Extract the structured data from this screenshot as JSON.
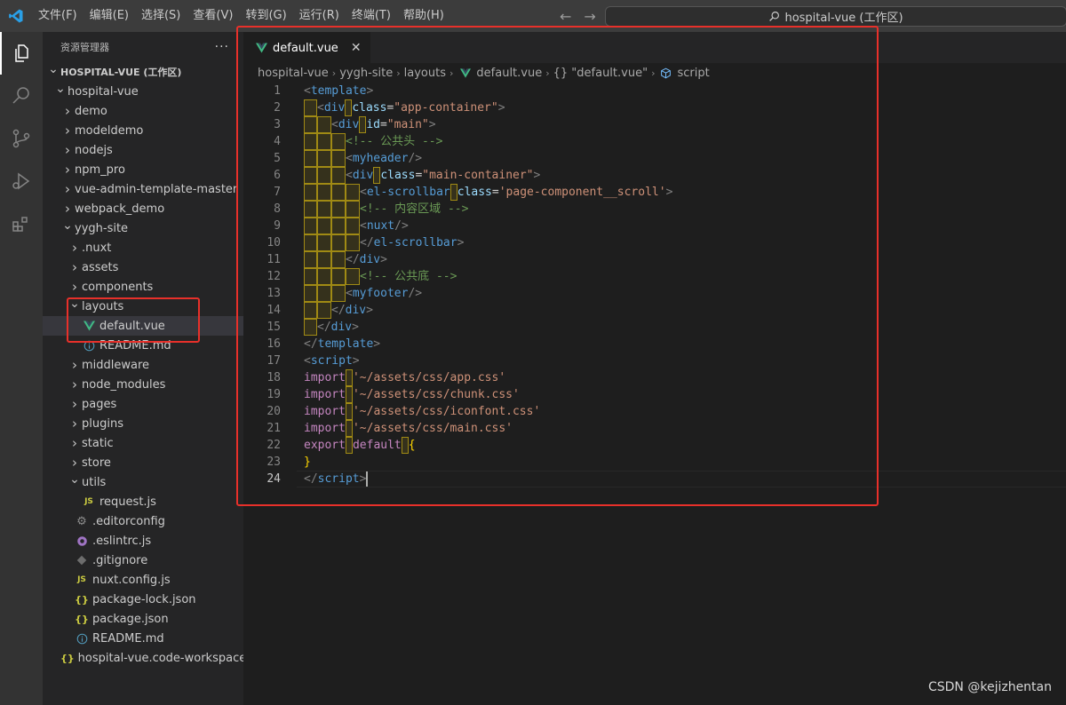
{
  "titlebar": {
    "menus": [
      "文件(F)",
      "编辑(E)",
      "选择(S)",
      "查看(V)",
      "转到(G)",
      "运行(R)",
      "终端(T)",
      "帮助(H)"
    ],
    "search_text": "hospital-vue (工作区)",
    "search_icon": "search-icon"
  },
  "activitybar": {
    "icons": [
      "explorer-icon",
      "search-icon",
      "source-control-icon",
      "run-debug-icon",
      "extensions-icon"
    ]
  },
  "sidebar": {
    "header": "资源管理器",
    "more": "···",
    "items": [
      {
        "label": "HOSPITAL-VUE (工作区)",
        "depth": 0,
        "kind": "workspace",
        "chev": "v"
      },
      {
        "label": "hospital-vue",
        "depth": 1,
        "kind": "folder",
        "chev": "v"
      },
      {
        "label": "demo",
        "depth": 2,
        "kind": "folder",
        "chev": ">"
      },
      {
        "label": "modeldemo",
        "depth": 2,
        "kind": "folder",
        "chev": ">"
      },
      {
        "label": "nodejs",
        "depth": 2,
        "kind": "folder",
        "chev": ">"
      },
      {
        "label": "npm_pro",
        "depth": 2,
        "kind": "folder",
        "chev": ">"
      },
      {
        "label": "vue-admin-template-master",
        "depth": 2,
        "kind": "folder",
        "chev": ">"
      },
      {
        "label": "webpack_demo",
        "depth": 2,
        "kind": "folder",
        "chev": ">"
      },
      {
        "label": "yygh-site",
        "depth": 2,
        "kind": "folder",
        "chev": "v"
      },
      {
        "label": ".nuxt",
        "depth": 3,
        "kind": "folder",
        "chev": ">"
      },
      {
        "label": "assets",
        "depth": 3,
        "kind": "folder",
        "chev": ">"
      },
      {
        "label": "components",
        "depth": 3,
        "kind": "folder",
        "chev": ">"
      },
      {
        "label": "layouts",
        "depth": 3,
        "kind": "folder",
        "chev": "v"
      },
      {
        "label": "default.vue",
        "depth": 4,
        "kind": "vue",
        "selected": true
      },
      {
        "label": "README.md",
        "depth": 4,
        "kind": "info"
      },
      {
        "label": "middleware",
        "depth": 3,
        "kind": "folder",
        "chev": ">"
      },
      {
        "label": "node_modules",
        "depth": 3,
        "kind": "folder",
        "chev": ">"
      },
      {
        "label": "pages",
        "depth": 3,
        "kind": "folder",
        "chev": ">"
      },
      {
        "label": "plugins",
        "depth": 3,
        "kind": "folder",
        "chev": ">"
      },
      {
        "label": "static",
        "depth": 3,
        "kind": "folder",
        "chev": ">"
      },
      {
        "label": "store",
        "depth": 3,
        "kind": "folder",
        "chev": ">"
      },
      {
        "label": "utils",
        "depth": 3,
        "kind": "folder",
        "chev": "v"
      },
      {
        "label": "request.js",
        "depth": 4,
        "kind": "js"
      },
      {
        "label": ".editorconfig",
        "depth": 3,
        "kind": "gear"
      },
      {
        "label": ".eslintrc.js",
        "depth": 3,
        "kind": "eslint"
      },
      {
        "label": ".gitignore",
        "depth": 3,
        "kind": "git"
      },
      {
        "label": "nuxt.config.js",
        "depth": 3,
        "kind": "js"
      },
      {
        "label": "package-lock.json",
        "depth": 3,
        "kind": "json"
      },
      {
        "label": "package.json",
        "depth": 3,
        "kind": "json"
      },
      {
        "label": "README.md",
        "depth": 3,
        "kind": "info"
      },
      {
        "label": "hospital-vue.code-workspace",
        "depth": 2,
        "kind": "json"
      }
    ]
  },
  "editor": {
    "tab": {
      "label": "default.vue",
      "close": "✕"
    },
    "breadcrumb": [
      "hospital-vue",
      "yygh-site",
      "layouts",
      "default.vue",
      "{} \"default.vue\"",
      "script"
    ],
    "current_line": 24,
    "lines": [
      [
        0,
        [
          [
            "t-punc",
            "<"
          ],
          [
            "t-tag",
            "template"
          ],
          [
            "t-punc",
            ">"
          ]
        ]
      ],
      [
        1,
        [
          [
            "t-punc",
            "<"
          ],
          [
            "t-tag",
            "div"
          ],
          [
            "sp",
            ""
          ],
          [
            "t-attr",
            "class"
          ],
          [
            "t-plain",
            "="
          ],
          [
            "t-str",
            "\"app-container\""
          ],
          [
            "t-punc",
            ">"
          ]
        ]
      ],
      [
        2,
        [
          [
            "t-punc",
            "<"
          ],
          [
            "t-tag",
            "div"
          ],
          [
            "sp",
            ""
          ],
          [
            "t-attr",
            "id"
          ],
          [
            "t-plain",
            "="
          ],
          [
            "t-str",
            "\"main\""
          ],
          [
            "t-punc",
            ">"
          ]
        ]
      ],
      [
        3,
        [
          [
            "t-com",
            "<!-- 公共头 -->"
          ]
        ]
      ],
      [
        3,
        [
          [
            "t-punc",
            "<"
          ],
          [
            "t-tag",
            "myheader"
          ],
          [
            "t-punc",
            "/>"
          ]
        ]
      ],
      [
        3,
        [
          [
            "t-punc",
            "<"
          ],
          [
            "t-tag",
            "div"
          ],
          [
            "sp",
            ""
          ],
          [
            "t-attr",
            "class"
          ],
          [
            "t-plain",
            "="
          ],
          [
            "t-str",
            "\"main-container\""
          ],
          [
            "t-punc",
            ">"
          ]
        ]
      ],
      [
        4,
        [
          [
            "t-punc",
            "<"
          ],
          [
            "t-tag",
            "el-scrollbar"
          ],
          [
            "sp",
            ""
          ],
          [
            "t-attr",
            "class"
          ],
          [
            "t-plain",
            "="
          ],
          [
            "t-str",
            "'page-component__scroll'"
          ],
          [
            "t-punc",
            ">"
          ]
        ]
      ],
      [
        4,
        [
          [
            "t-com",
            "<!-- 内容区域 -->"
          ]
        ]
      ],
      [
        4,
        [
          [
            "t-punc",
            "<"
          ],
          [
            "t-tag",
            "nuxt"
          ],
          [
            "t-punc",
            "/>"
          ]
        ]
      ],
      [
        4,
        [
          [
            "t-punc",
            "</"
          ],
          [
            "t-tag",
            "el-scrollbar"
          ],
          [
            "t-punc",
            ">"
          ]
        ]
      ],
      [
        3,
        [
          [
            "t-punc",
            "</"
          ],
          [
            "t-tag",
            "div"
          ],
          [
            "t-punc",
            ">"
          ]
        ]
      ],
      [
        4,
        [
          [
            "t-com",
            "<!-- 公共底 -->"
          ]
        ]
      ],
      [
        3,
        [
          [
            "t-punc",
            "<"
          ],
          [
            "t-tag",
            "myfooter"
          ],
          [
            "t-punc",
            "/>"
          ]
        ]
      ],
      [
        2,
        [
          [
            "t-punc",
            "</"
          ],
          [
            "t-tag",
            "div"
          ],
          [
            "t-punc",
            ">"
          ]
        ]
      ],
      [
        1,
        [
          [
            "t-punc",
            "</"
          ],
          [
            "t-tag",
            "div"
          ],
          [
            "t-punc",
            ">"
          ]
        ]
      ],
      [
        0,
        [
          [
            "t-punc",
            "</"
          ],
          [
            "t-tag",
            "template"
          ],
          [
            "t-punc",
            ">"
          ]
        ]
      ],
      [
        0,
        [
          [
            "t-punc",
            "<"
          ],
          [
            "t-tag",
            "script"
          ],
          [
            "t-punc",
            ">"
          ]
        ]
      ],
      [
        0,
        [
          [
            "t-kw",
            "import"
          ],
          [
            "sp",
            ""
          ],
          [
            "t-str",
            "'~/assets/css/app.css'"
          ]
        ]
      ],
      [
        0,
        [
          [
            "t-kw",
            "import"
          ],
          [
            "sp",
            ""
          ],
          [
            "t-str",
            "'~/assets/css/chunk.css'"
          ]
        ]
      ],
      [
        0,
        [
          [
            "t-kw",
            "import"
          ],
          [
            "sp",
            ""
          ],
          [
            "t-str",
            "'~/assets/css/iconfont.css'"
          ]
        ]
      ],
      [
        0,
        [
          [
            "t-kw",
            "import"
          ],
          [
            "sp",
            ""
          ],
          [
            "t-str",
            "'~/assets/css/main.css'"
          ]
        ]
      ],
      [
        0,
        [
          [
            "t-kw",
            "export"
          ],
          [
            "sp",
            ""
          ],
          [
            "t-kw",
            "default"
          ],
          [
            "sp",
            ""
          ],
          [
            "t-brace",
            "{"
          ]
        ]
      ],
      [
        0,
        [
          [
            "t-brace",
            "}"
          ]
        ]
      ],
      [
        0,
        [
          [
            "t-punc",
            "</"
          ],
          [
            "t-tag",
            "script"
          ],
          [
            "t-punc",
            ">"
          ]
        ]
      ]
    ]
  },
  "watermark": "CSDN @kejizhentan",
  "colors": {
    "highlight_box": "#e8302a",
    "vue_green": "#41b883",
    "json_yellow": "#cbcb41"
  }
}
